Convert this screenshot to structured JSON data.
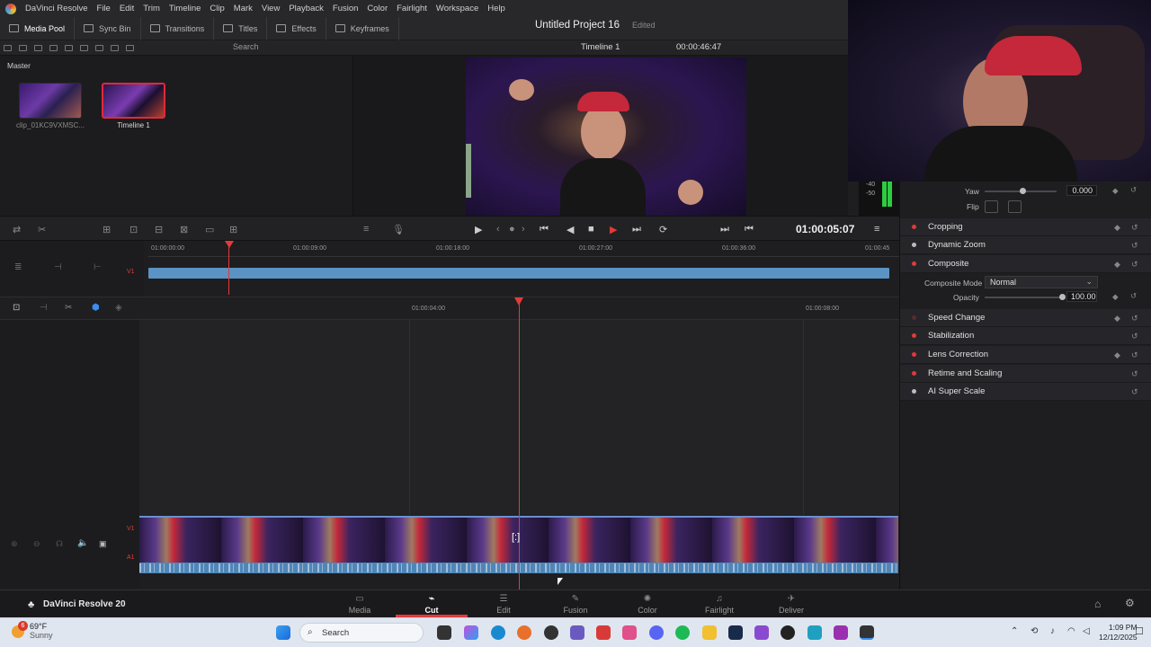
{
  "menu": {
    "app": "DaVinci Resolve",
    "items": [
      "File",
      "Edit",
      "Trim",
      "Timeline",
      "Clip",
      "Mark",
      "View",
      "Playback",
      "Fusion",
      "Color",
      "Fairlight",
      "Workspace",
      "Help"
    ]
  },
  "toolbar": {
    "media_pool": "Media Pool",
    "sync_bin": "Sync Bin",
    "transitions": "Transitions",
    "titles": "Titles",
    "effects": "Effects",
    "keyframes": "Keyframes"
  },
  "project": {
    "title": "Untitled Project 16",
    "status": "Edited"
  },
  "viewer": {
    "timeline_name": "Timeline 1",
    "duration": "00:00:46:47",
    "timecode": "01:00:05:07"
  },
  "search": {
    "placeholder": "Search"
  },
  "pool": {
    "bin": "Master",
    "clips": [
      {
        "name": "clip_01KC9VXMSC..."
      },
      {
        "name": "Timeline 1"
      }
    ]
  },
  "ruler_top": [
    "01:00:00:00",
    "01:00:09:00",
    "01:00:18:00",
    "01:00:27:00",
    "01:00:36:00",
    "01:00:45"
  ],
  "ruler_bottom": [
    "01:00:04:00",
    "01:00:08:00"
  ],
  "tracks": {
    "v1": "V1",
    "a1": "A1"
  },
  "inspector": {
    "yaw_label": "Yaw",
    "yaw_value": "0.000",
    "flip_label": "Flip",
    "cropping": "Cropping",
    "dynamic_zoom": "Dynamic Zoom",
    "composite": "Composite",
    "composite_mode_label": "Composite Mode",
    "composite_mode_value": "Normal",
    "opacity_label": "Opacity",
    "opacity_value": "100.00",
    "speed_change": "Speed Change",
    "stabilization": "Stabilization",
    "lens_correction": "Lens Correction",
    "retime_scaling": "Retime and Scaling",
    "ai_super_scale": "AI Super Scale"
  },
  "meter": {
    "top": "-40",
    "bottom": "-50"
  },
  "pages": {
    "brand": "DaVinci Resolve 20",
    "media": "Media",
    "cut": "Cut",
    "edit": "Edit",
    "fusion": "Fusion",
    "color": "Color",
    "fairlight": "Fairlight",
    "deliver": "Deliver"
  },
  "taskbar": {
    "temp": "69°F",
    "weather": "Sunny",
    "search": "Search",
    "time": "1:09 PM",
    "date": "12/12/2025",
    "badge": "6"
  }
}
